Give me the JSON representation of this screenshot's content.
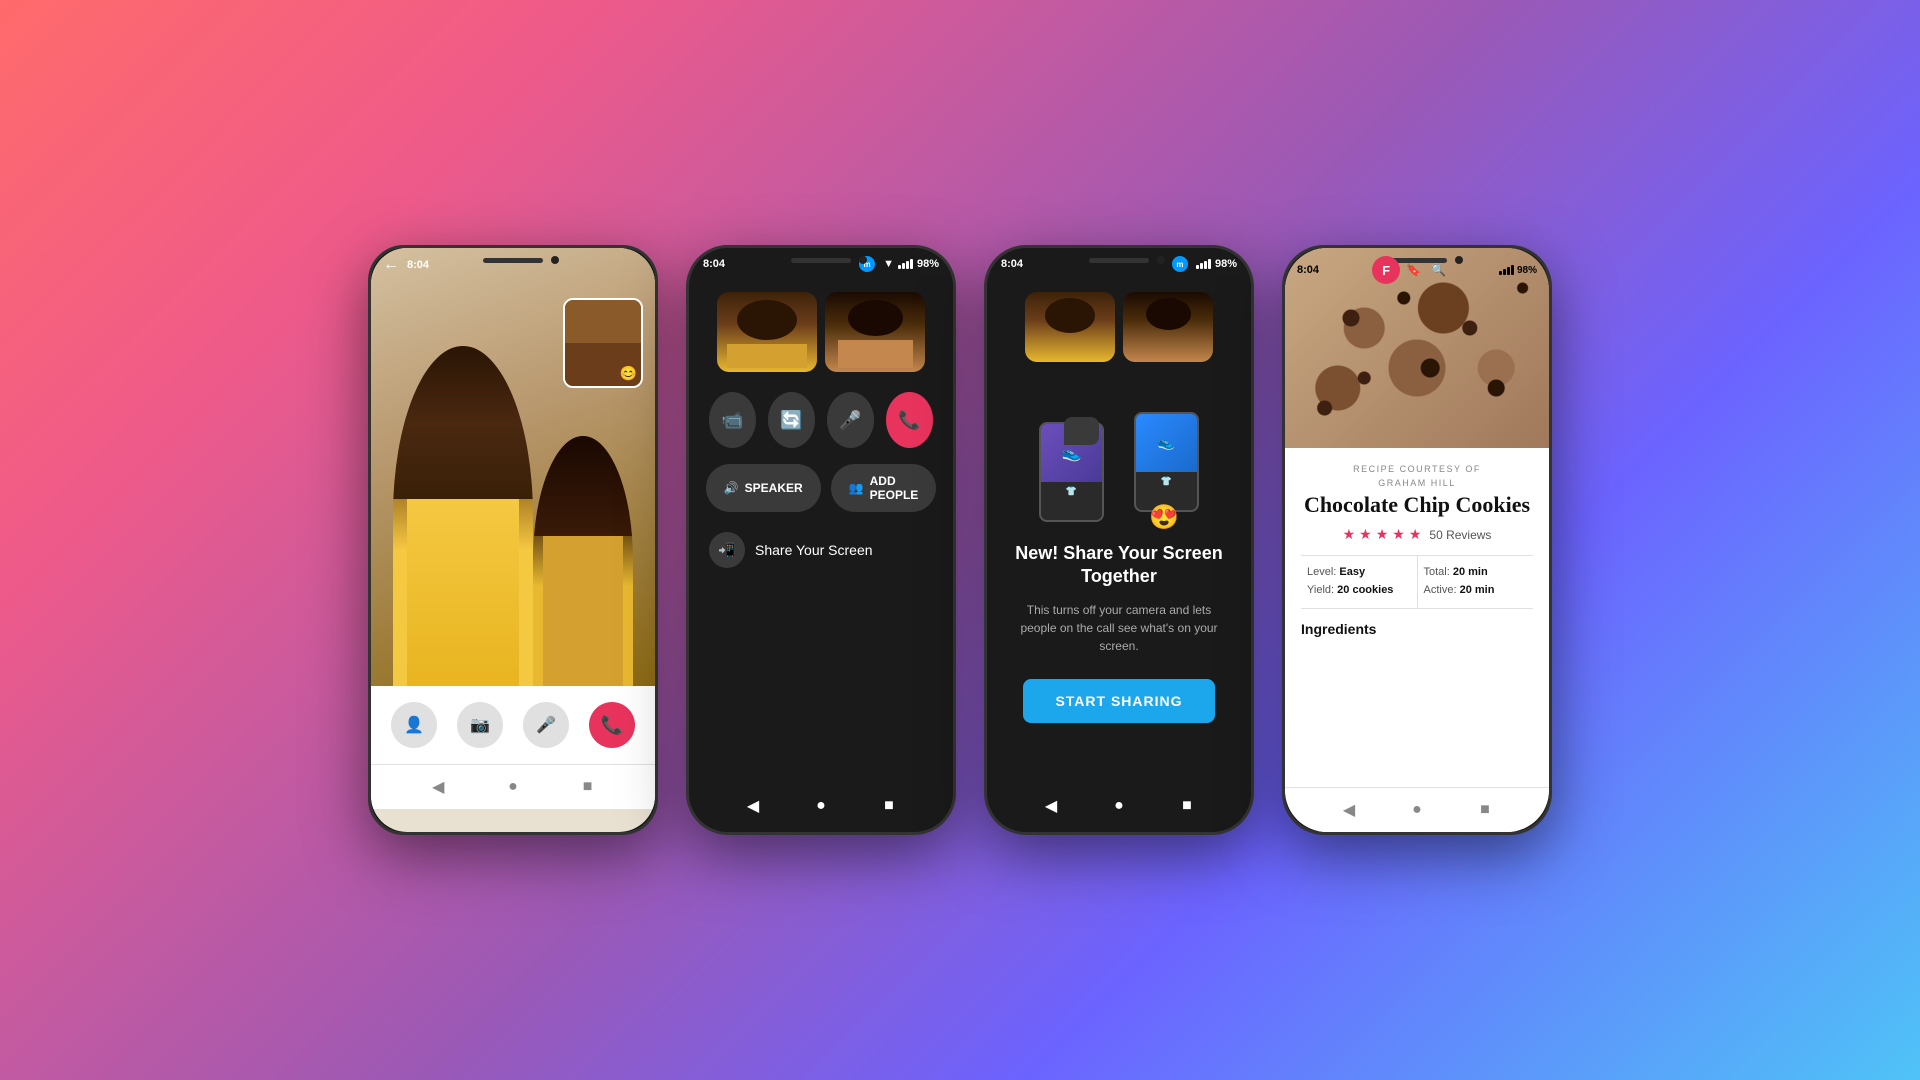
{
  "background": {
    "gradient": "linear-gradient(135deg, #ff6b6b 0%, #ee5a8a 20%, #9b59b6 50%, #6c63ff 70%, #4fc3f7 100%)"
  },
  "phone1": {
    "type": "video_call",
    "status_bar": {
      "time": "8:04"
    },
    "controls": {
      "add_person": "👤+",
      "flip_camera": "📷",
      "mic": "🎤",
      "end_call": "📞"
    },
    "nav": {
      "back": "◀",
      "home": "●",
      "square": "■"
    }
  },
  "phone2": {
    "type": "messenger_call",
    "status_bar": {
      "time": "8:04",
      "battery": "98%"
    },
    "buttons": {
      "video": "📹",
      "flip": "🔄",
      "mic": "🎤",
      "end": "📞"
    },
    "options": {
      "speaker": "SPEAKER",
      "add_people": "ADD PEOPLE"
    },
    "share_screen": {
      "label": "Share Your Screen"
    },
    "nav": {
      "back": "◀",
      "home": "●",
      "square": "■"
    }
  },
  "phone3": {
    "type": "screen_share_feature",
    "status_bar": {
      "time": "8:04",
      "battery": "98%"
    },
    "feature": {
      "title": "New! Share Your Screen Together",
      "description": "This turns off your camera and lets people on the call see what's on your screen.",
      "button_label": "START SHARING"
    },
    "nav": {
      "back": "◀",
      "home": "●",
      "square": "■"
    }
  },
  "phone4": {
    "type": "recipe_app",
    "status_bar": {
      "time": "8:04",
      "battery": "98%"
    },
    "recipe": {
      "courtesy_label": "RECIPE COURTESY OF",
      "author": "GRAHAM HILL",
      "title": "Chocolate Chip Cookies",
      "stars": 4.5,
      "reviews": "50 Reviews",
      "level_label": "Level:",
      "level_value": "Easy",
      "yield_label": "Yield:",
      "yield_value": "20 cookies",
      "total_label": "Total:",
      "total_value": "20 min",
      "active_label": "Active:",
      "active_value": "20 min",
      "ingredients_heading": "Ingredients"
    },
    "nav": {
      "back": "◀",
      "home": "●",
      "square": "■"
    }
  }
}
